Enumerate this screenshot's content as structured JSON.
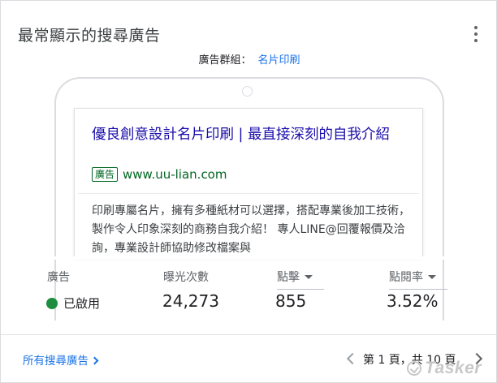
{
  "card": {
    "title": "最常顯示的搜尋廣告",
    "menu_icon": "more-vert-icon"
  },
  "ad_group": {
    "label": "廣告群組：",
    "name": "名片印刷"
  },
  "ad_preview": {
    "headline": "優良創意設計名片印刷 | 最直接深刻的自我介紹",
    "badge": "廣告",
    "display_url": "www.uu-lian.com",
    "description": "印刷專屬名片，擁有多種紙材可以選擇，搭配專業後加工技術，製作令人印象深刻的商務自我介紹！ 專人LINE@回覆報價及洽詢，專業設計師協助修改檔案與"
  },
  "stats": {
    "headers": {
      "ad": "廣告",
      "impressions": "曝光次數",
      "clicks": "點擊",
      "ctr": "點閱率"
    },
    "status": "已啟用",
    "status_color": "#1e8e3e",
    "impressions": "24,273",
    "clicks": "855",
    "ctr": "3.52%"
  },
  "footer": {
    "all_ads_link": "所有搜尋廣告",
    "pagination": "第 1 頁，共 10 頁"
  },
  "watermark": {
    "text": "Tasker"
  },
  "colors": {
    "link_blue": "#1a73e8",
    "headline_blue": "#1a0dab",
    "url_green": "#006621"
  }
}
